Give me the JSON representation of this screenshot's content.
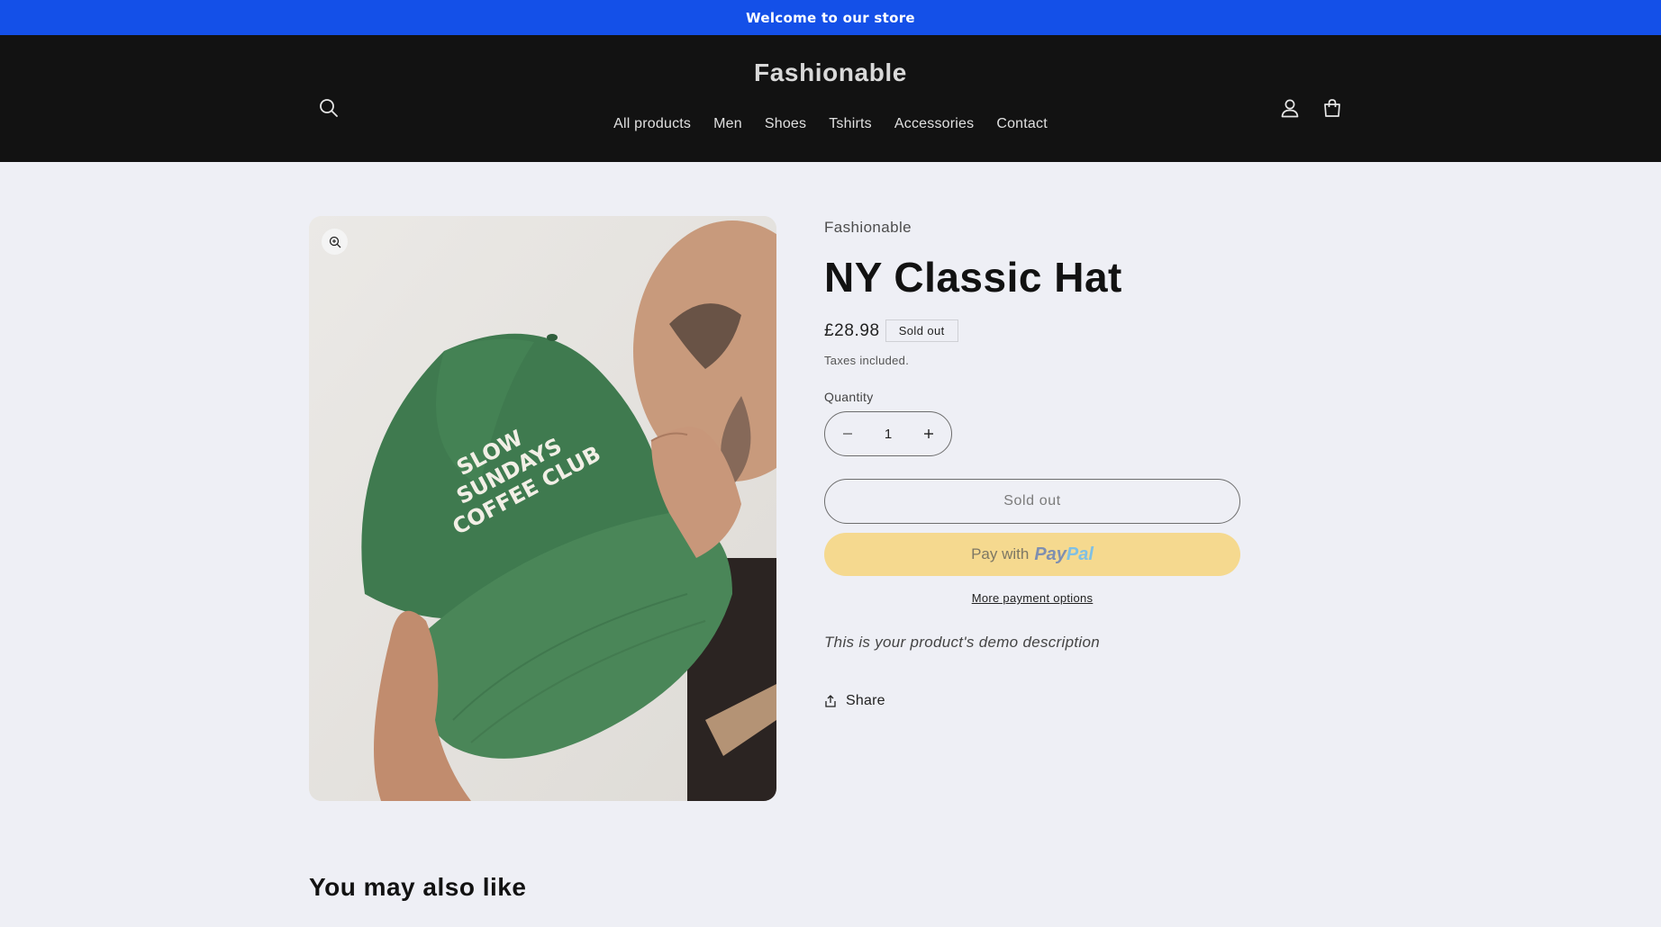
{
  "announcement": {
    "text": "Welcome to our store",
    "bg_color": "#1450e8"
  },
  "header": {
    "logo": "Fashionable",
    "icons": {
      "search": "search-icon",
      "account": "account-icon",
      "cart": "cart-icon"
    },
    "nav": [
      "All products",
      "Men",
      "Shoes",
      "Tshirts",
      "Accessories",
      "Contact"
    ]
  },
  "product": {
    "vendor": "Fashionable",
    "title": "NY Classic Hat",
    "price": "£28.98",
    "badge": "Sold out",
    "tax_note": "Taxes included.",
    "quantity_label": "Quantity",
    "quantity_value": "1",
    "add_button": "Sold out",
    "paypal": {
      "prefix": "Pay with",
      "brand_a": "Pay",
      "brand_b": "Pal"
    },
    "more_payment": "More payment options",
    "description": "This is your product's demo description",
    "share": "Share",
    "image": {
      "cap_text": [
        "SLOW",
        "SUNDAYS",
        "COFFEE CLUB"
      ],
      "cap_color": "#3f7a4f"
    }
  },
  "related": {
    "heading": "You may also like"
  }
}
